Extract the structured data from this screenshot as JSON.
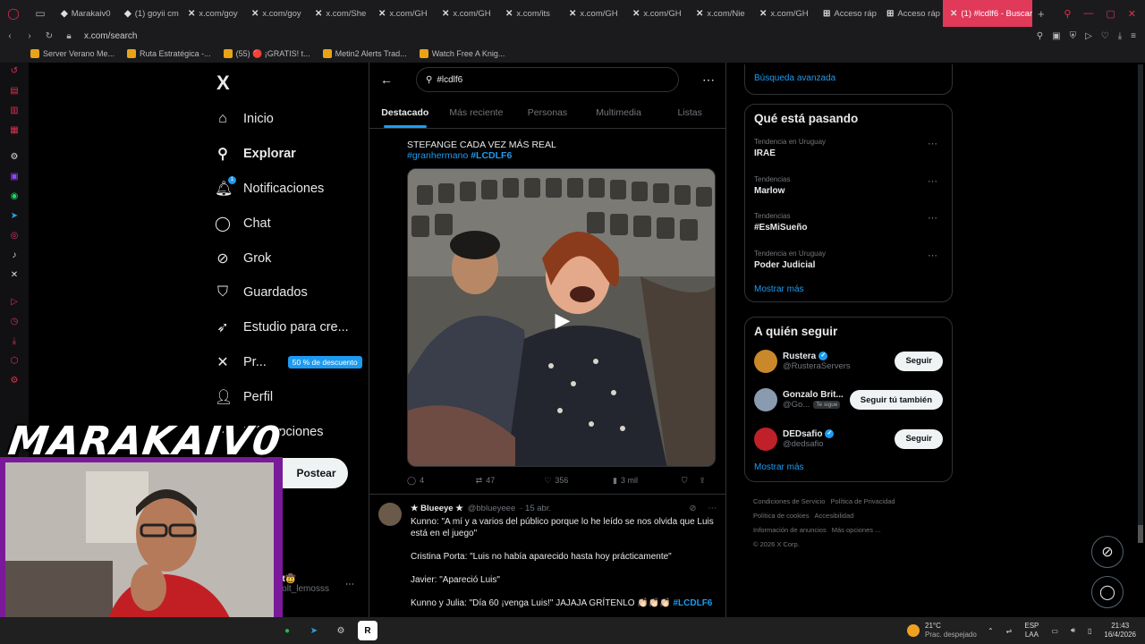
{
  "browser": {
    "tabs": [
      "Marakaiv0",
      "(1) goyii cm",
      "x.com/goy",
      "x.com/goy",
      "x.com/She",
      "x.com/GH",
      "x.com/GH",
      "x.com/its",
      "x.com/GH",
      "x.com/GH",
      "x.com/Nie",
      "x.com/GH",
      "Acceso ráp",
      "Acceso ráp",
      "(1) #lcdlf6 - Buscar /"
    ],
    "url": "x.com/search",
    "bookmarks": [
      "Server Verano Me...",
      "Ruta Estratégica -...",
      "(55) 🔴 ¡GRATIS! t...",
      "Metin2 Alerts Trad...",
      "Watch Free A Knig..."
    ]
  },
  "nav": {
    "logo": "X",
    "items": [
      {
        "label": "Inicio",
        "icon": "home-icon",
        "glyph": "⌂"
      },
      {
        "label": "Explorar",
        "icon": "search-icon",
        "glyph": "⚲",
        "bold": true
      },
      {
        "label": "Notificaciones",
        "icon": "bell-icon",
        "glyph": "🔔︎",
        "badge": "1"
      },
      {
        "label": "Chat",
        "icon": "chat-icon",
        "glyph": "◯"
      },
      {
        "label": "Grok",
        "icon": "grok-icon",
        "glyph": "⊘"
      },
      {
        "label": "Guardados",
        "icon": "bookmark-icon",
        "glyph": "⛉"
      },
      {
        "label": "Estudio para cre...",
        "icon": "rocket-icon",
        "glyph": "➶"
      },
      {
        "label": "Pr...",
        "icon": "x-premium-icon",
        "glyph": "✕",
        "promo": "50 % de descuento"
      },
      {
        "label": "Perfil",
        "icon": "profile-icon",
        "glyph": "👤︎"
      },
      {
        "label": "Más opciones",
        "icon": "more-options-icon",
        "glyph": "⋯"
      }
    ],
    "post_button": "Postear",
    "profile_name": "Solt🤠",
    "profile_handle": "@solt_lemosss"
  },
  "search": {
    "query": "#lcdlf6",
    "tabs": [
      "Destacado",
      "Más reciente",
      "Personas",
      "Multimedia",
      "Listas"
    ],
    "active_tab": 0
  },
  "post1": {
    "text": "STEFANGE CADA VEZ MÁS REAL",
    "hashtag1": "#granhermano",
    "hashtag2": "#LCDLF6",
    "replies": "4",
    "reposts": "47",
    "likes": "356",
    "views": "3 mil"
  },
  "post2": {
    "name": "★ Blueeye ★",
    "handle": "@bblueyeee",
    "date": "· 15 abr.",
    "lines": [
      "Kunno: \"A mí y a varios del público porque lo he leído se nos olvida que Luis está en el juego\"",
      "Cristina Porta: \"Luis no había aparecido hasta hoy prácticamente\"",
      "Javier: \"Apareció Luis\""
    ],
    "last_line": "Kunno y Julia: \"Día 60 ¡venga Luis!\" JAJAJA GRÍTENLO 👏🏻👏🏻👏🏻",
    "last_hashtag": "#LCDLF6"
  },
  "sidebar": {
    "advanced_search": "Búsqueda avanzada",
    "trends_title": "Qué está pasando",
    "trends": [
      {
        "context": "Tendencia en Uruguay",
        "name": "IRAE"
      },
      {
        "context": "Tendencias",
        "name": "Marlow"
      },
      {
        "context": "Tendencias",
        "name": "#EsMiSueño"
      },
      {
        "context": "Tendencia en Uruguay",
        "name": "Poder Judicial"
      }
    ],
    "show_more": "Mostrar más",
    "follow_title": "A quién seguir",
    "follow": [
      {
        "name": "Rustera",
        "handle": "@RusteraServers",
        "verified": true,
        "button": "Seguir",
        "color": "#c9882a"
      },
      {
        "name": "Gonzalo Brit...",
        "handle": "@Go...",
        "tag": "Te sigue",
        "button": "Seguir tú también",
        "color": "#8a9bb0"
      },
      {
        "name": "DEDsafio",
        "handle": "@dedsafio",
        "verified": true,
        "button": "Seguir",
        "color": "#c0202a"
      }
    ],
    "show_more2": "Mostrar más",
    "footer": [
      "Condiciones de Servicio",
      "Política de Privacidad",
      "Política de cookies",
      "Accesibilidad",
      "Información de anuncios",
      "Más opciones ...",
      "© 2026 X Corp."
    ]
  },
  "overlay": {
    "banner": "MARAKAIV0"
  },
  "taskbar": {
    "temp": "21°C",
    "weather": "Prac. despejado",
    "lang1": "ESP",
    "lang2": "LAA",
    "time": "21:43",
    "date": "16/4/2026"
  },
  "colors": {
    "accent": "#1d9bf0",
    "opera": "#e03050",
    "background": "#000000"
  }
}
